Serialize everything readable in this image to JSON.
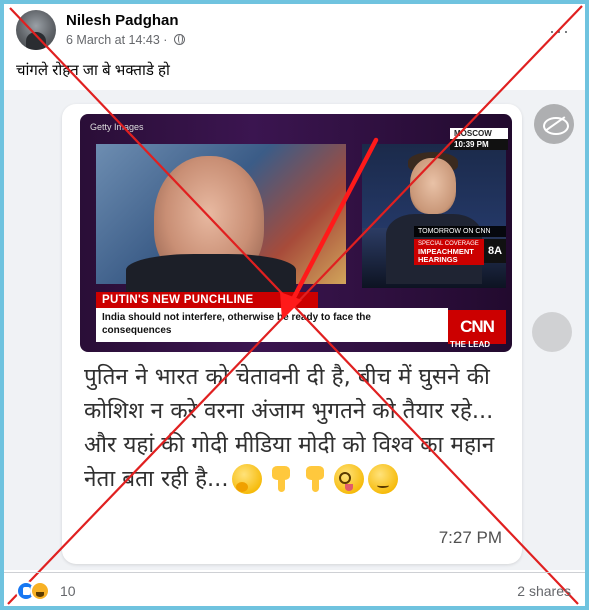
{
  "post": {
    "author": "Nilesh Padghan",
    "timestamp": "6 March at 14:43 ·",
    "caption": "चांगले रोहत जा बे भक्ताडे हो",
    "more_icon": "···"
  },
  "video": {
    "getty": "Getty Images",
    "location": "MOSCOW",
    "location_time": "10:39 PM",
    "tonight_text": "TOMORROW ON CNN",
    "special_label": "SPECIAL COVERAGE",
    "special_title": "IMPEACHMENT HEARINGS",
    "ratings": "8A",
    "headline": "PUTIN'S NEW PUNCHLINE",
    "subline": "India should not interfere, otherwise be ready to face the consequences",
    "network_logo": "CNN",
    "show_name": "THE LEAD"
  },
  "message": {
    "text": "पुतिन ने भारत को चेतावनी दी है, बीच में घुसने की कोशिश न करे वरना अंजाम भुगतने को तैयार रहे... और यहां की गोदी मीडिया मोदी को विश्व का महान नेता बता रही है...",
    "time": "7:27 PM",
    "emojis": [
      "thinking-face",
      "backhand-index-pointing-down",
      "backhand-index-pointing-down",
      "woozy-face",
      "smirking-face"
    ]
  },
  "footer": {
    "reaction_count": "10",
    "shares": "2 shares"
  },
  "colors": {
    "frame_border": "#6fc3df",
    "cross_red": "#e02020",
    "cnn_red": "#cc0000",
    "like_blue": "#1877f2"
  }
}
